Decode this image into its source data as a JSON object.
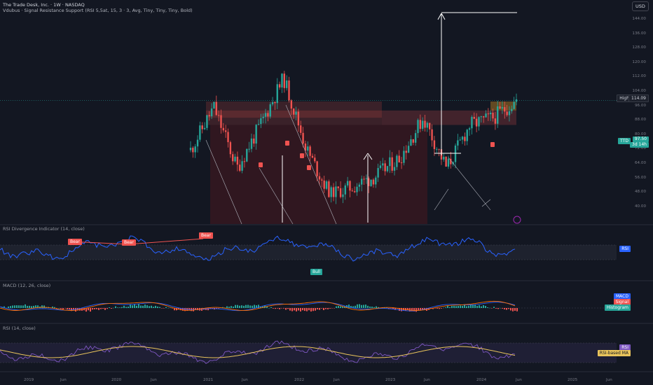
{
  "header": {
    "title": "The Trade Desk, Inc. · 1W · NASDAQ",
    "indicator": "Vdubus · Signal Resistance Support (RSI 5,5at, 15, 3 · 3, Avg, Tiny, Tiny, Tiny, Bold)",
    "currency": "USD"
  },
  "panes": {
    "rsi_div_title": "RSI Divergence Indicator (14, close)",
    "macd_title": "MACD (12, 26, close)",
    "rsi_title": "RSI (14, close)"
  },
  "price_axis": {
    "ticks": [
      "144.00",
      "136.00",
      "128.00",
      "120.00",
      "112.00",
      "104.00",
      "96.00",
      "88.00",
      "80.00",
      "72.00",
      "64.00",
      "56.00",
      "48.00",
      "40.00"
    ],
    "high_label": "High",
    "high_value": "114.09",
    "ticker": "TTD",
    "last_price": "97.50",
    "countdown": "3d 14h"
  },
  "right_labels": {
    "rsi": "RSI",
    "macd": "MACD",
    "signal": "Signal",
    "histogram": "Histogram",
    "rsi2": "RSI",
    "rsi_ma": "RSI-based MA"
  },
  "div_labels": {
    "bear1": "Bear",
    "bear2": "Bear",
    "bear3": "Bear",
    "bull": "Bull"
  },
  "time_axis": {
    "ticks": [
      "2019",
      "Jun",
      "2020",
      "Jun",
      "2021",
      "Jun",
      "2022",
      "Jun",
      "2023",
      "Jun",
      "2024",
      "Jun",
      "2025",
      "Jun"
    ]
  },
  "colors": {
    "background": "#131722",
    "up": "#26a69a",
    "down": "#ef5350",
    "rsi_line": "#2962ff",
    "signal": "#ff6d00",
    "rsi_ma": "#e8c35b",
    "rsi2": "#7e57c2"
  },
  "chart_data": {
    "type": "candlestick",
    "price_range": [
      40,
      148
    ],
    "last_price": 97.5,
    "high": 114.09,
    "weekly_close_approx": {
      "x": [
        "2020-10",
        "2021-02",
        "2021-04",
        "2021-07",
        "2021-11",
        "2022-02",
        "2022-05",
        "2022-09",
        "2023-01",
        "2023-04",
        "2023-07",
        "2023-10",
        "2024-02",
        "2024-05",
        "2024-07"
      ],
      "y": [
        70,
        94,
        60,
        84,
        110,
        70,
        45,
        50,
        56,
        66,
        88,
        60,
        84,
        88,
        97.5
      ]
    },
    "resistance_zones": [
      {
        "from": 84,
        "to": 97,
        "label": ""
      },
      {
        "from": 40,
        "to": 92,
        "label": ""
      }
    ],
    "rsi_range": [
      0,
      100
    ],
    "rsi_bands": [
      30,
      70
    ]
  }
}
